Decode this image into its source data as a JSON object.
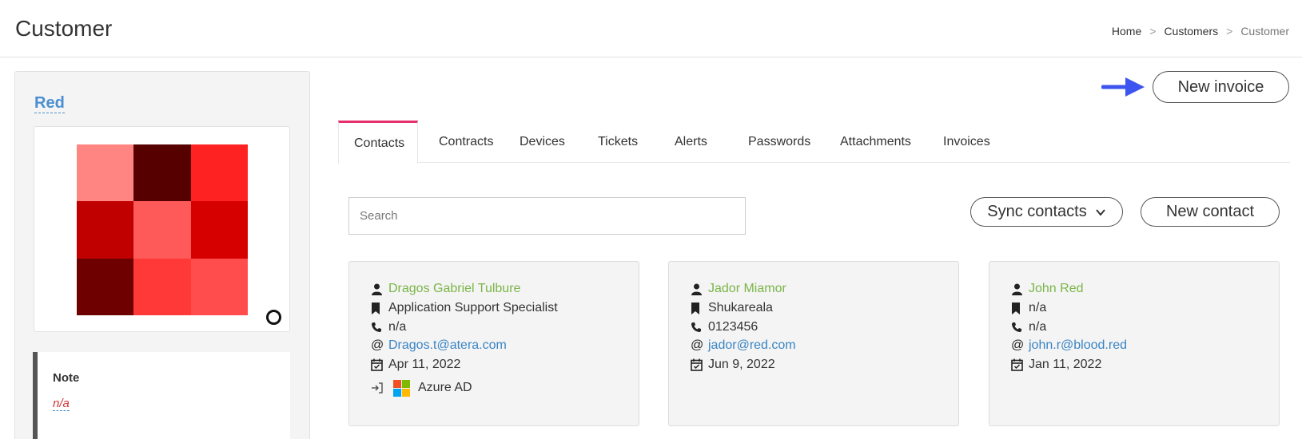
{
  "header": {
    "title": "Customer",
    "breadcrumb": [
      "Home",
      "Customers",
      "Customer"
    ],
    "separator": ">"
  },
  "customer": {
    "name": "Red",
    "avatar_colors": [
      "#ff8582",
      "#560000",
      "#ff2222",
      "#c00000",
      "#ff5a5a",
      "#d60000",
      "#6e0000",
      "#ff3838",
      "#ff4d4d"
    ],
    "note_title": "Note",
    "note_value": "n/a"
  },
  "actions": {
    "new_invoice": "New invoice",
    "arrow_color": "#3d55f0"
  },
  "tabs": [
    {
      "label": "Contacts",
      "active": true
    },
    {
      "label": "Contracts",
      "active": false
    },
    {
      "label": "Devices",
      "active": false
    },
    {
      "label": "Tickets",
      "active": false
    },
    {
      "label": "Alerts",
      "active": false
    },
    {
      "label": "Passwords",
      "active": false
    },
    {
      "label": "Attachments",
      "active": false
    },
    {
      "label": "Invoices",
      "active": false
    }
  ],
  "contacts_toolbar": {
    "search_placeholder": "Search",
    "sync_label": "Sync contacts",
    "new_contact_label": "New contact"
  },
  "contacts": [
    {
      "name": "Dragos Gabriel Tulbure",
      "title": "Application Support Specialist",
      "phone": "n/a",
      "email": "Dragos.t@atera.com",
      "date": "Apr 11, 2022",
      "source": "Azure AD"
    },
    {
      "name": "Jador Miamor",
      "title": "Shukareala",
      "phone": "0123456",
      "email": "jador@red.com",
      "date": "Jun 9, 2022"
    },
    {
      "name": "John Red",
      "title": "n/a",
      "phone": "n/a",
      "email": "john.r@blood.red",
      "date": "Jan 11, 2022"
    }
  ],
  "colors": {
    "tab_active_accent": "#e5306b",
    "link_green": "#7ab547",
    "link_blue": "#3a84c4"
  }
}
